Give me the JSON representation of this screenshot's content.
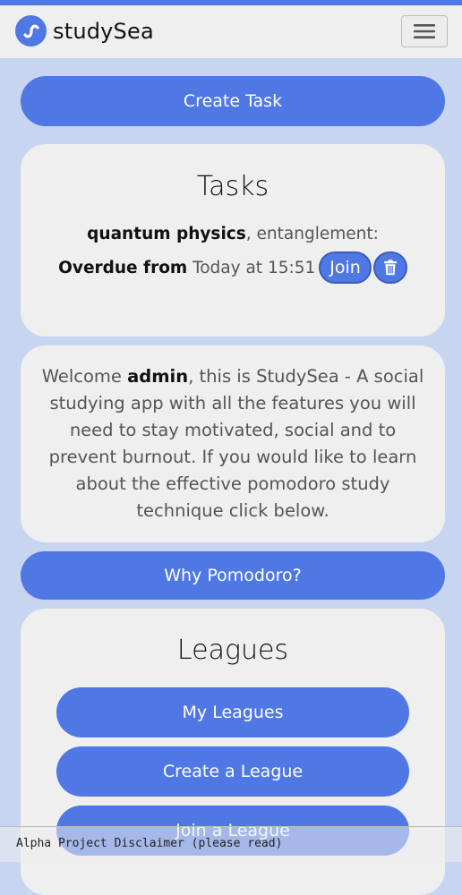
{
  "nav": {
    "brand": "studySea",
    "menu_icon": "hamburger-icon",
    "logo_icon": "wave-logo-icon"
  },
  "actions": {
    "create_task": "Create Task",
    "why_pomodoro": "Why Pomodoro?"
  },
  "tasks": {
    "title": "Tasks",
    "items": [
      {
        "subject": "quantum physics",
        "topic": ", entanglement:",
        "status_label": "Overdue from",
        "due": " Today at 15:51",
        "join_label": "Join",
        "delete_icon": "trash-icon"
      }
    ]
  },
  "welcome": {
    "prefix": "Welcome ",
    "username": "admin",
    "body": ", this is StudySea - A social studying app with all the features you will need to stay motivated, social and to prevent burnout. If you would like to learn about the effective pomodoro study technique click below."
  },
  "leagues": {
    "title": "Leagues",
    "my_leagues": "My Leagues",
    "create_league": "Create a League",
    "join_league": "Join a League"
  },
  "footer": {
    "disclaimer": "Alpha Project Disclaimer (please read)"
  },
  "colors": {
    "accent": "#4f78e5",
    "page_bg": "#c8d5f0",
    "card_bg": "#efefef"
  }
}
